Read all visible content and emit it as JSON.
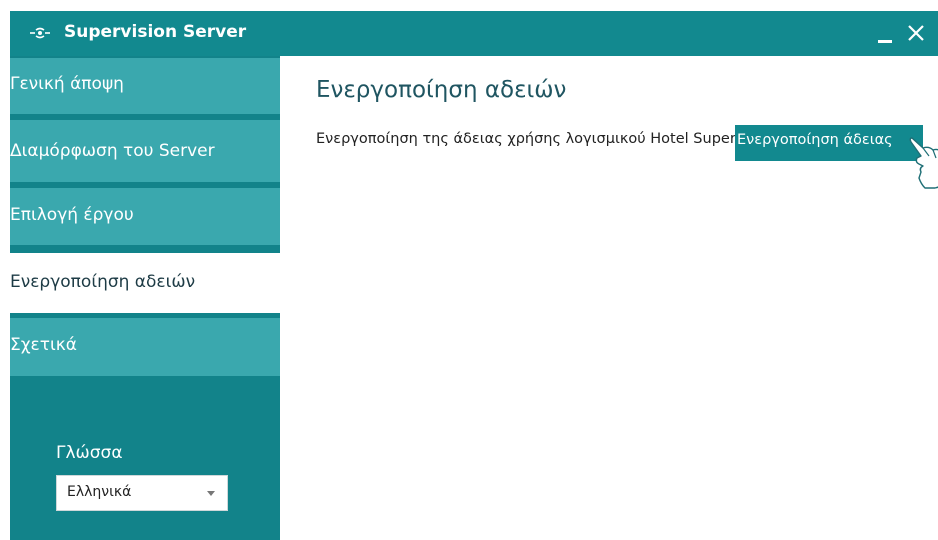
{
  "window": {
    "title": "Supervision Server",
    "icons": {
      "app": "supervision-logo-icon",
      "minimize": "minimize-icon",
      "close": "close-icon"
    }
  },
  "sidebar": {
    "items": [
      {
        "label": "Γενική άποψη",
        "active": false
      },
      {
        "label": "Διαμόρφωση του Server",
        "active": false
      },
      {
        "label": "Επιλογή έργου",
        "active": false
      },
      {
        "label": "Ενεργοποίηση αδειών",
        "active": true
      },
      {
        "label": "Σχετικά",
        "active": false
      }
    ],
    "language": {
      "label": "Γλώσσα",
      "selected": "Ελληνικά"
    }
  },
  "main": {
    "title": "Ενεργοποίηση αδειών",
    "description": "Ενεργοποίηση της άδειας χρήσης λογισμικού Hotel Supervision",
    "activate_button": "Ενεργοποίηση άδειας"
  },
  "colors": {
    "titlebar": "#12898f",
    "sidebar": "#12838a",
    "nav_item": "#3aa8ae",
    "active_item": "#ffffff",
    "accent_button": "#12898f",
    "title_text": "#1f5561"
  }
}
